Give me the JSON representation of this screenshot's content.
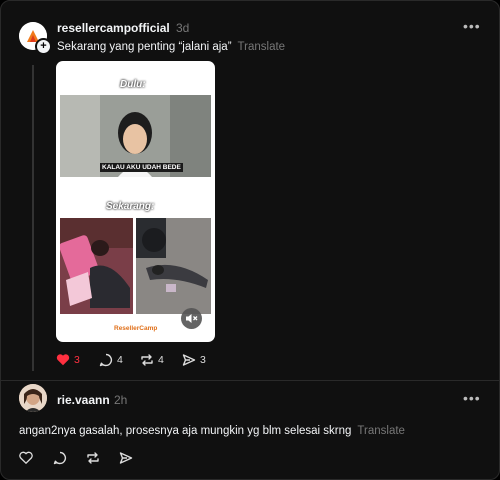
{
  "post": {
    "username": "resellercampofficial",
    "time": "3d",
    "text": "Sekarang yang penting “jalani aja”",
    "translate": "Translate",
    "media": {
      "caption_top": "Dulu:",
      "subtitle": "KALAU AKU UDAH BEDE",
      "caption_bottom": "Sekarang:",
      "logo_text": "ResellerCamp"
    },
    "stats": {
      "likes": "3",
      "replies": "4",
      "reposts": "4",
      "shares": "3"
    },
    "like_color": "#ff3040"
  },
  "reply": {
    "username": "rie.vaann",
    "time": "2h",
    "text": "angan2nya gasalah, prosesnya aja mungkin yg blm selesai skrng",
    "translate": "Translate"
  }
}
